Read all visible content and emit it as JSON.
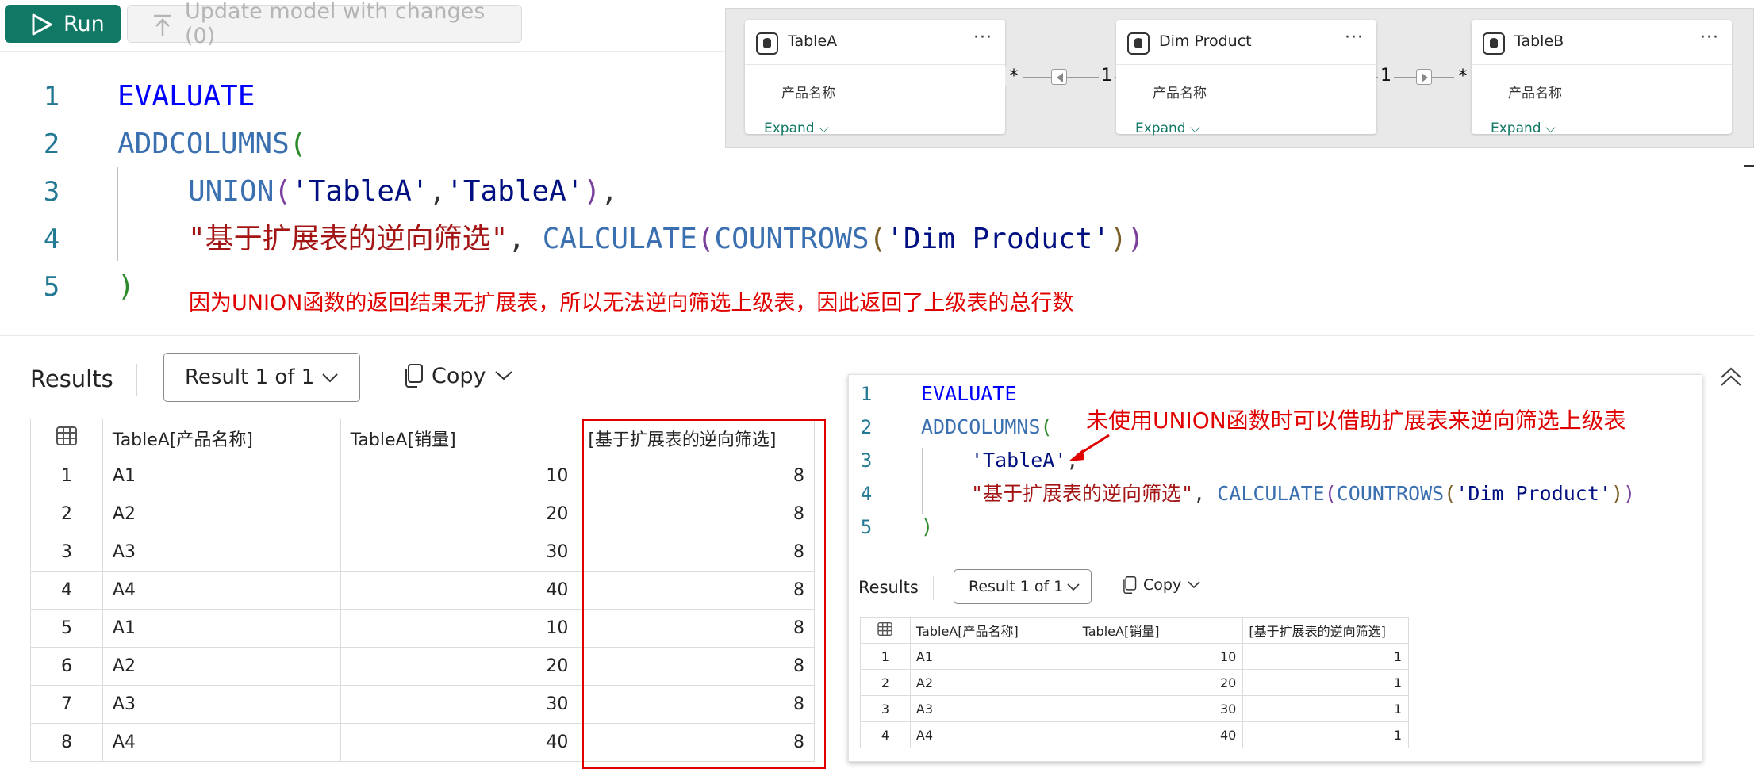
{
  "toolbar": {
    "run_label": "Run",
    "update_label": "Update model with changes (0)"
  },
  "editor": {
    "line_numbers": [
      "1",
      "2",
      "3",
      "4",
      "5"
    ],
    "evaluate": "EVALUATE",
    "addcolumns": "ADDCOLUMNS",
    "union": "UNION",
    "table_a_ref": "'TableA'",
    "col_name": "\"基于扩展表的逆向筛选\"",
    "calculate": "CALCULATE",
    "countrows": "COUNTROWS",
    "dim_product_ref": "'Dim Product'",
    "note": "因为UNION函数的返回结果无扩展表，所以无法逆向筛选上级表，因此返回了上级表的总行数"
  },
  "model": {
    "tables": [
      {
        "title": "TableA",
        "field": "产品名称",
        "expand": "Expand"
      },
      {
        "title": "Dim Product",
        "field": "产品名称",
        "expand": "Expand"
      },
      {
        "title": "TableB",
        "field": "产品名称",
        "expand": "Expand"
      }
    ],
    "rel1": {
      "from": "*",
      "to": "1"
    },
    "rel2": {
      "from": "1",
      "to": "*"
    },
    "more": "···"
  },
  "results": {
    "title": "Results",
    "result_selector": "Result 1 of 1",
    "copy_label": "Copy",
    "headers": [
      "TableA[产品名称]",
      "TableA[销量]",
      "[基于扩展表的逆向筛选]"
    ],
    "rows": [
      {
        "idx": "1",
        "name": "A1",
        "sales": "10",
        "value": "8"
      },
      {
        "idx": "2",
        "name": "A2",
        "sales": "20",
        "value": "8"
      },
      {
        "idx": "3",
        "name": "A3",
        "sales": "30",
        "value": "8"
      },
      {
        "idx": "4",
        "name": "A4",
        "sales": "40",
        "value": "8"
      },
      {
        "idx": "5",
        "name": "A1",
        "sales": "10",
        "value": "8"
      },
      {
        "idx": "6",
        "name": "A2",
        "sales": "20",
        "value": "8"
      },
      {
        "idx": "7",
        "name": "A3",
        "sales": "30",
        "value": "8"
      },
      {
        "idx": "8",
        "name": "A4",
        "sales": "40",
        "value": "8"
      }
    ]
  },
  "inset": {
    "line_numbers": [
      "1",
      "2",
      "3",
      "4",
      "5"
    ],
    "evaluate": "EVALUATE",
    "addcolumns": "ADDCOLUMNS",
    "table_a_ref": "'TableA'",
    "col_name": "\"基于扩展表的逆向筛选\"",
    "calculate": "CALCULATE",
    "countrows": "COUNTROWS",
    "dim_product_ref": "'Dim Product'",
    "note": "未使用UNION函数时可以借助扩展表来逆向筛选上级表",
    "results_title": "Results",
    "result_selector": "Result 1 of 1",
    "copy_label": "Copy",
    "headers": [
      "TableA[产品名称]",
      "TableA[销量]",
      "[基于扩展表的逆向筛选]"
    ],
    "rows": [
      {
        "idx": "1",
        "name": "A1",
        "sales": "10",
        "value": "1"
      },
      {
        "idx": "2",
        "name": "A2",
        "sales": "20",
        "value": "1"
      },
      {
        "idx": "3",
        "name": "A3",
        "sales": "30",
        "value": "1"
      },
      {
        "idx": "4",
        "name": "A4",
        "sales": "40",
        "value": "1"
      }
    ]
  },
  "colors": {
    "run_green": "#117865",
    "annotation_red": "#e00000",
    "keyword_blue": "#0000ff"
  }
}
